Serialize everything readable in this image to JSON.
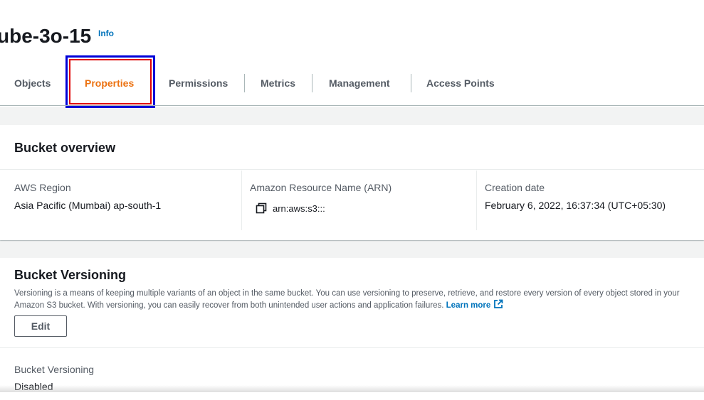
{
  "header": {
    "title_fragment": "ube-3o-15",
    "info_label": "Info"
  },
  "tabs": [
    {
      "label": "Objects",
      "active": false
    },
    {
      "label": "Properties",
      "active": true
    },
    {
      "label": "Permissions",
      "active": false
    },
    {
      "label": "Metrics",
      "active": false
    },
    {
      "label": "Management",
      "active": false
    },
    {
      "label": "Access Points",
      "active": false
    }
  ],
  "overview": {
    "title": "Bucket overview",
    "region_label": "AWS Region",
    "region_value": "Asia Pacific (Mumbai) ap-south-1",
    "arn_label": "Amazon Resource Name (ARN)",
    "arn_value": "arn:aws:s3:::",
    "date_label": "Creation date",
    "date_value": "February 6, 2022, 16:37:34 (UTC+05:30)"
  },
  "versioning": {
    "title": "Bucket Versioning",
    "description": "Versioning is a means of keeping multiple variants of an object in the same bucket. You can use versioning to preserve, retrieve, and restore every version of every object stored in your Amazon S3 bucket. With versioning, you can easily recover from both unintended user actions and application failures.",
    "learn_more": "Learn more",
    "edit_label": "Edit",
    "status_label": "Bucket Versioning",
    "status_value": "Disabled"
  },
  "icons": {
    "copy": "copy-icon",
    "external_link": "external-link-icon"
  },
  "colors": {
    "active_tab": "#ec7211",
    "link": "#0073bb",
    "highlight_outer": "#0000d8",
    "highlight_inner": "#e00000"
  }
}
